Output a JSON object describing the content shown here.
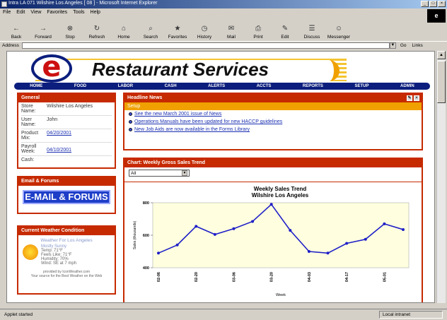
{
  "window": {
    "title": "Intra LA 071 Wilshire Los Angeles [ 08 ] - Microsoft Internet Explorer",
    "buttons": [
      "_",
      "□",
      "×"
    ]
  },
  "menubar": [
    "File",
    "Edit",
    "View",
    "Favorites",
    "Tools",
    "Help"
  ],
  "toolbar": [
    "Back",
    "Forward",
    "Stop",
    "Refresh",
    "Home",
    "Search",
    "Favorites",
    "History",
    "Mail",
    "Print",
    "Edit",
    "Discuss",
    "Messenger"
  ],
  "address": {
    "label": "Address",
    "go": "Go",
    "links": "Links"
  },
  "status": {
    "left": "Applet started",
    "right": "Local intranet"
  },
  "banner": {
    "logo_letter": "e",
    "brand": "Restaurant Services"
  },
  "nav": [
    "HOME",
    "FOOD",
    "LABOR",
    "CASH",
    "ALERTS",
    "ACCTS",
    "REPORTS",
    "SETUP",
    "ADMIN"
  ],
  "general": {
    "title": "General",
    "rows": [
      {
        "k": "Store Name:",
        "v": "Wilshire Los Angeles",
        "link": false
      },
      {
        "k": "User Name:",
        "v": "John",
        "link": false
      },
      {
        "k": "Product Mix:",
        "v": "04/20/2001",
        "link": true
      },
      {
        "k": "Payroll Week:",
        "v": "04/10/2001",
        "link": true
      },
      {
        "k": "Cash:",
        "v": "",
        "link": false
      }
    ]
  },
  "email": {
    "title": "Email & Forums",
    "button": "E-MAIL & FORUMS"
  },
  "weather": {
    "title": "Current Weather Condition",
    "heading": "Weather For Los Angeles",
    "condition": "Mostly Sunny",
    "lines": [
      "Temp: 71°F",
      "Feels Like: 71°F",
      "Humidity: 70%",
      "Wind: SE at 7 mph"
    ],
    "footer1": "provided by IconWeather.com",
    "footer2": "Your source for the Best Weather on the Web"
  },
  "news": {
    "title": "Headline News",
    "subtitle": "Setup",
    "items": [
      "See the new March 2001 issue of News",
      "Operations Manuals have been updated for new HACCP guidelines",
      "New Job Aids are now available in the Forms Library"
    ]
  },
  "chartpanel": {
    "title": "Chart: Weekly Gross Sales Trend",
    "select": "All"
  },
  "chart_data": {
    "type": "line",
    "title": "Weekly Sales Trend",
    "subtitle": "Wilshire Los Angeles",
    "xlabel": "Week",
    "ylabel": "Sales (thousands)",
    "ylim": [
      4000,
      8000
    ],
    "yticks": [
      4000,
      6000,
      8000
    ],
    "yticklabels": [
      "400",
      "600",
      "800"
    ],
    "x": [
      "02-06",
      "02-13",
      "02-20",
      "02-27",
      "03-06",
      "03-13",
      "03-20",
      "03-27",
      "04-03",
      "04-10",
      "04-17",
      "04-24",
      "05-01",
      "05-08"
    ],
    "xticklabels": [
      "02-06",
      "",
      "02-20",
      "",
      "03-06",
      "",
      "03-20",
      "",
      "04-03",
      "",
      "04-17",
      "",
      "05-01",
      ""
    ],
    "values": [
      4900,
      5400,
      6550,
      6050,
      6400,
      6850,
      7900,
      6300,
      5000,
      4900,
      5500,
      5750,
      6700,
      6350
    ],
    "grid": false,
    "line_color": "#1f1fc8",
    "plot_bg": "#ffffe0"
  }
}
